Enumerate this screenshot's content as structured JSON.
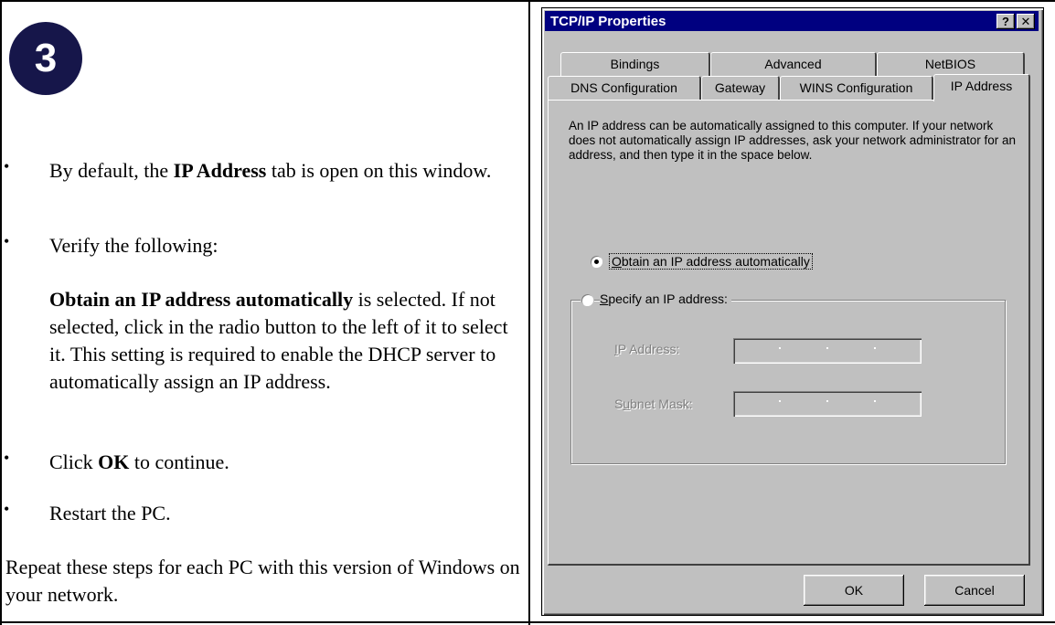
{
  "step": {
    "number": "3"
  },
  "instructions": {
    "bullet": "•",
    "item1": {
      "prefix": "By default, the ",
      "bold": "IP Address",
      "suffix": " tab is open on this window."
    },
    "item2": {
      "text": "Verify the following:"
    },
    "item3": {
      "bold": "Obtain an IP address automatically",
      "suffix": " is selected. If not selected, click in the radio button to the left of it to select it.  This setting is required to enable the DHCP server to automatically assign an IP address."
    },
    "item4": {
      "prefix": "Click ",
      "bold": "OK",
      "suffix": " to continue."
    },
    "item5": {
      "text": "Restart the PC."
    },
    "footer": "Repeat these steps for each PC with this version of Windows on your network."
  },
  "dialog": {
    "title": "TCP/IP Properties",
    "help_glyph": "?",
    "close_glyph": "✕",
    "tabs_back": [
      "Bindings",
      "Advanced",
      "NetBIOS"
    ],
    "tabs_front": [
      "DNS Configuration",
      "Gateway",
      "WINS Configuration",
      "IP Address"
    ],
    "active_tab": "IP Address",
    "description": "An IP address can be automatically assigned to this computer. If your network does not automatically assign IP addresses, ask your network administrator for an address, and then type it in the space below.",
    "radio_auto": {
      "mnemonic": "O",
      "rest": "btain an IP address automatically",
      "checked": true
    },
    "radio_specify": {
      "mnemonic": "S",
      "rest": "pecify an IP address:",
      "checked": false
    },
    "ip_label": {
      "mnemonic": "I",
      "rest": "P Address:"
    },
    "mask_label": {
      "pre": "S",
      "mnemonic": "u",
      "rest": "bnet Mask:"
    },
    "ok_label": "OK",
    "cancel_label": "Cancel"
  },
  "colors": {
    "badge": "#16164a",
    "titlebar": "#000080",
    "face": "#c0c0c0"
  }
}
